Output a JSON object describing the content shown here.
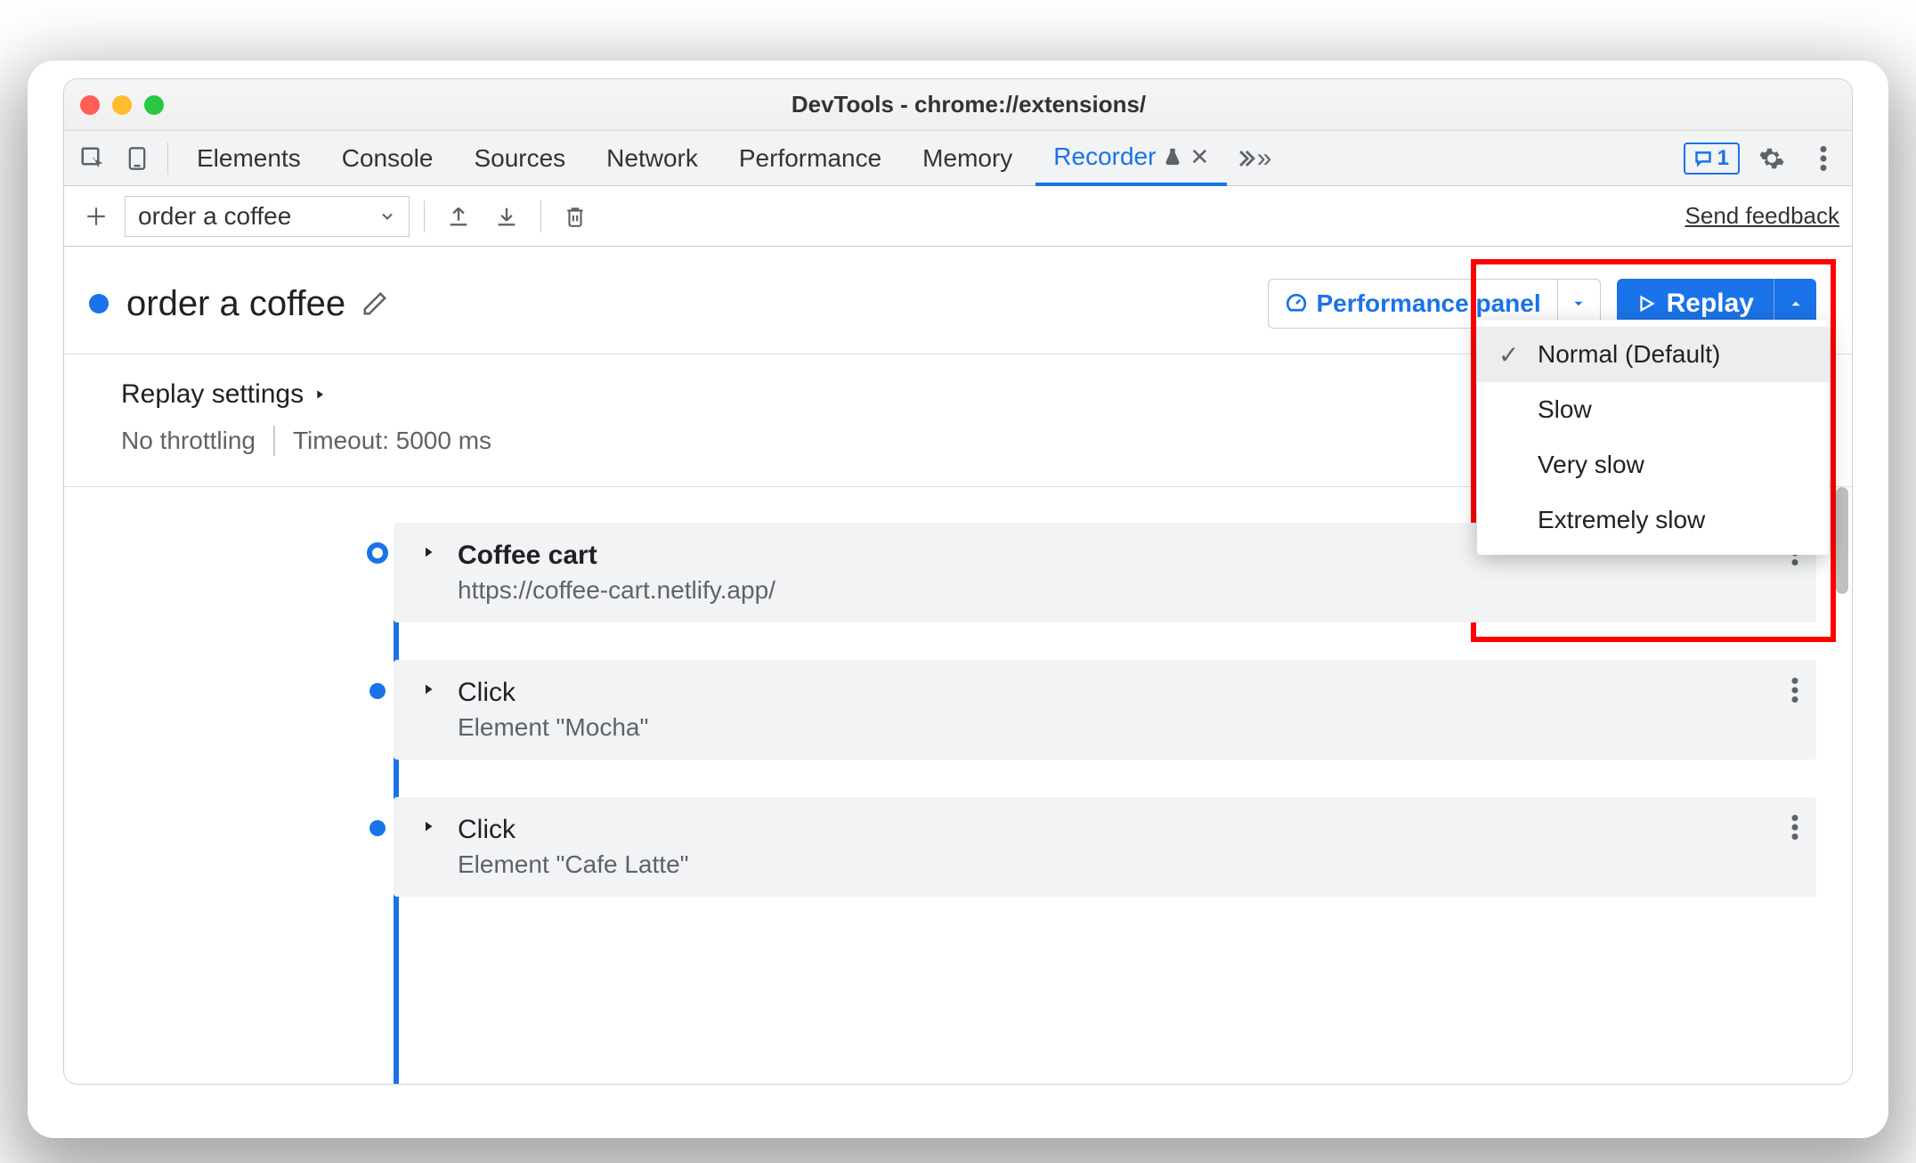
{
  "window": {
    "title": "DevTools - chrome://extensions/"
  },
  "tabs": {
    "items": [
      "Elements",
      "Console",
      "Sources",
      "Network",
      "Performance",
      "Memory"
    ],
    "active": {
      "label": "Recorder"
    },
    "issues_count": "1"
  },
  "toolbar": {
    "recording_name": "order a coffee",
    "feedback_link": "Send feedback"
  },
  "header": {
    "name": "order a coffee",
    "perf_button": "Performance panel",
    "replay_button": "Replay"
  },
  "speed_menu": {
    "items": [
      {
        "label": "Normal (Default)",
        "selected": true
      },
      {
        "label": "Slow",
        "selected": false
      },
      {
        "label": "Very slow",
        "selected": false
      },
      {
        "label": "Extremely slow",
        "selected": false
      }
    ]
  },
  "settings": {
    "title": "Replay settings",
    "throttling": "No throttling",
    "timeout": "Timeout: 5000 ms"
  },
  "steps": [
    {
      "title": "Coffee cart",
      "subtitle": "https://coffee-cart.netlify.app/",
      "first": true
    },
    {
      "title": "Click",
      "subtitle": "Element \"Mocha\"",
      "first": false
    },
    {
      "title": "Click",
      "subtitle": "Element \"Cafe Latte\"",
      "first": false
    }
  ]
}
